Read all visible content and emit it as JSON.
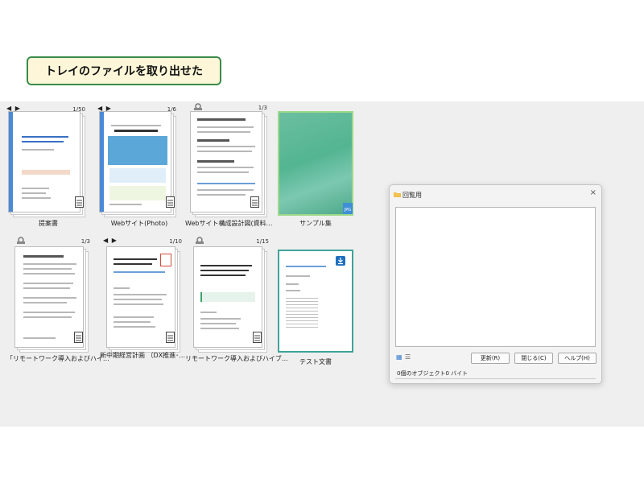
{
  "banner": {
    "text": "トレイのファイルを取り出せた"
  },
  "colors": {
    "banner_border": "#3a8b4a",
    "banner_bg": "#fdf6d8",
    "spine_blue": "#4a8ad8",
    "green_frame": "#3fa36a",
    "workspace": "#efefef"
  },
  "nav_arrows": "◀ ▶",
  "cards": [
    {
      "name": "teian",
      "label": "提案書",
      "count": "1/50"
    },
    {
      "name": "website-photo",
      "label": "Webサイト(Photo)",
      "count": "1/6"
    },
    {
      "name": "website-design",
      "label": "Webサイト構成設計図(資料…",
      "count": "1/3"
    },
    {
      "name": "sample",
      "label": "サンプル集",
      "count": ""
    },
    {
      "name": "remote-work-1",
      "label": "「リモートワーク導入およびハイ…",
      "count": "1/3"
    },
    {
      "name": "midterm-plan",
      "label": "新中期経営計画 （DX推進･…",
      "count": "1/10"
    },
    {
      "name": "remote-work-2",
      "label": "リモートワーク導入およびハイブ…",
      "count": "1/15"
    },
    {
      "name": "test-doc",
      "label": "テスト文書",
      "count": ""
    }
  ],
  "dialog": {
    "title": "回覧用",
    "close": "×",
    "buttons": {
      "refresh": "更新(R)",
      "close": "閉じる(C)",
      "help": "ヘルプ(H)"
    },
    "status": "0個のオブジェクト0 バイト",
    "view_icons": {
      "grid": "▦",
      "list": "☰"
    }
  }
}
